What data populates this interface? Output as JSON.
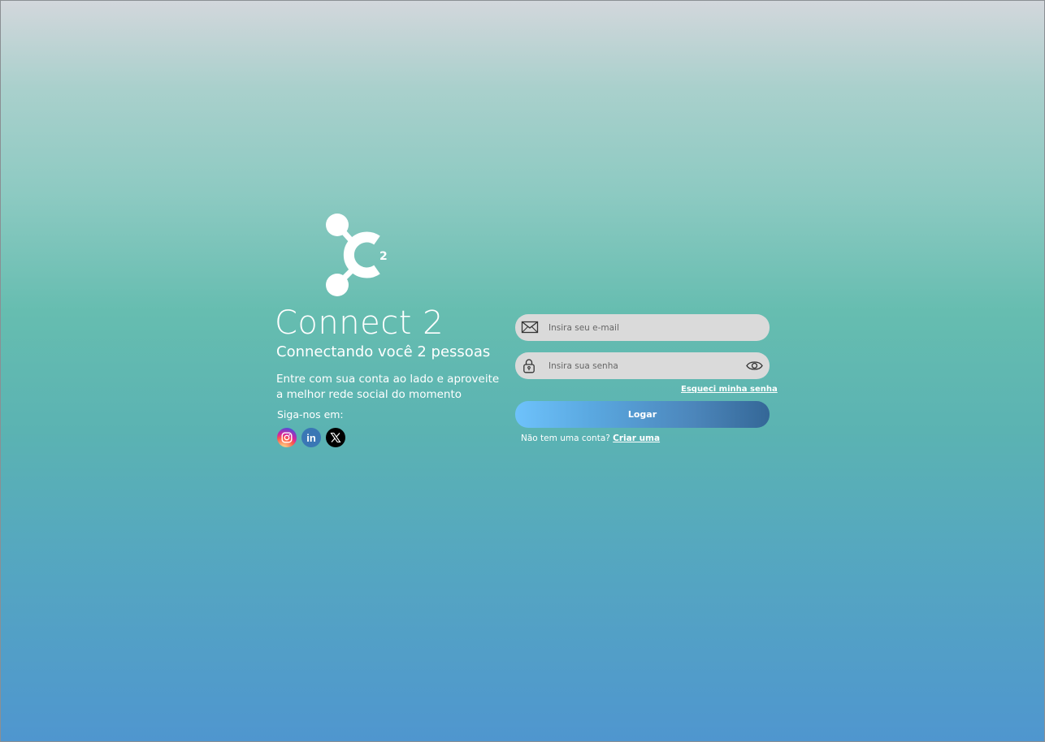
{
  "brand": {
    "logo_icon": "connect2-logo-icon",
    "logo_superscript": "2",
    "title": "Connect 2",
    "tagline": "Connectando você 2 pessoas",
    "description": "Entre com sua conta ao lado e aproveite a melhor rede social do momento"
  },
  "social": {
    "label": "Siga-nos em:",
    "items": [
      {
        "name": "instagram",
        "icon": "instagram-icon"
      },
      {
        "name": "linkedin",
        "icon": "linkedin-icon",
        "glyph": "in"
      },
      {
        "name": "x",
        "icon": "x-icon"
      }
    ]
  },
  "form": {
    "email": {
      "icon": "mail-icon",
      "placeholder": "Insira seu e-mail",
      "value": ""
    },
    "password": {
      "icon": "lock-icon",
      "placeholder": "Insira sua senha",
      "value": "",
      "toggle_icon": "eye-icon"
    },
    "forgot_password": "Esqueci minha senha",
    "submit_label": "Logar",
    "signup_prompt": "Não tem uma conta?",
    "signup_link": "Criar uma"
  },
  "colors": {
    "background_top": "#d3d7dc",
    "background_middle": "#66bdb0",
    "background_bottom": "#4f96cf",
    "input_background": "#dadada",
    "button_start": "#6ec2fb",
    "button_end": "#346797"
  }
}
